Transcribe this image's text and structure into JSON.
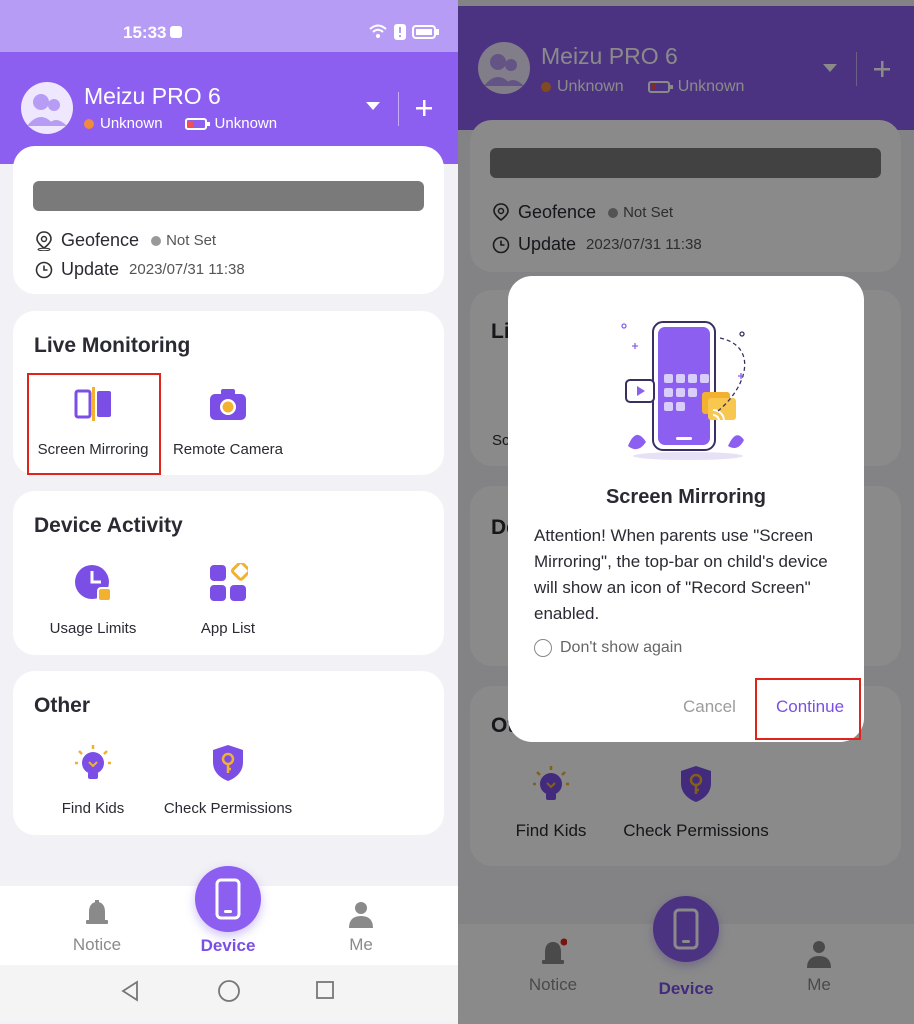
{
  "left": {
    "status_time": "15:33",
    "header": {
      "device_name": "Meizu PRO 6",
      "status_text": "Unknown",
      "battery_text": "Unknown"
    },
    "location": {
      "geofence_label": "Geofence",
      "geofence_value": "Not Set",
      "update_label": "Update",
      "update_value": "2023/07/31 11:38"
    },
    "live_monitoring": {
      "title": "Live Monitoring",
      "items": [
        {
          "label": "Screen Mirroring",
          "icon": "screen-mirroring-icon"
        },
        {
          "label": "Remote Camera",
          "icon": "camera-icon"
        }
      ]
    },
    "device_activity": {
      "title": "Device Activity",
      "items": [
        {
          "label": "Usage Limits",
          "icon": "clock-icon"
        },
        {
          "label": "App List",
          "icon": "grid-icon"
        }
      ]
    },
    "other": {
      "title": "Other",
      "items": [
        {
          "label": "Find Kids",
          "icon": "lightbulb-icon"
        },
        {
          "label": "Check Permissions",
          "icon": "shield-key-icon"
        }
      ]
    },
    "nav": {
      "notice": "Notice",
      "device": "Device",
      "me": "Me"
    }
  },
  "right": {
    "header": {
      "device_name": "Meizu PRO 6",
      "status_text": "Unknown",
      "battery_text": "Unknown"
    },
    "location": {
      "geofence_label": "Geofence",
      "geofence_value": "Not Set",
      "update_label": "Update",
      "update_value": "2023/07/31 11:38"
    },
    "partial_labels": {
      "live_monitoring": "Li",
      "screen_item": "Sc",
      "device_activity": "De",
      "usage_item": "U",
      "other": "Ot"
    },
    "other_items": [
      {
        "label": "Find Kids",
        "icon": "lightbulb-icon"
      },
      {
        "label": "Check Permissions",
        "icon": "shield-key-icon"
      }
    ],
    "dialog": {
      "title": "Screen Mirroring",
      "body": "Attention! When parents use \"Screen Mirroring\", the top-bar on child's device will show an icon of \"Record Screen\" enabled.",
      "checkbox_label": "Don't show again",
      "cancel": "Cancel",
      "continue": "Continue"
    },
    "nav": {
      "notice": "Notice",
      "device": "Device",
      "me": "Me"
    }
  },
  "colors": {
    "primary": "#8c5ff0",
    "status_bar": "#b79cf5",
    "highlight": "#e0231b",
    "status_dot": "#f08a3c"
  }
}
